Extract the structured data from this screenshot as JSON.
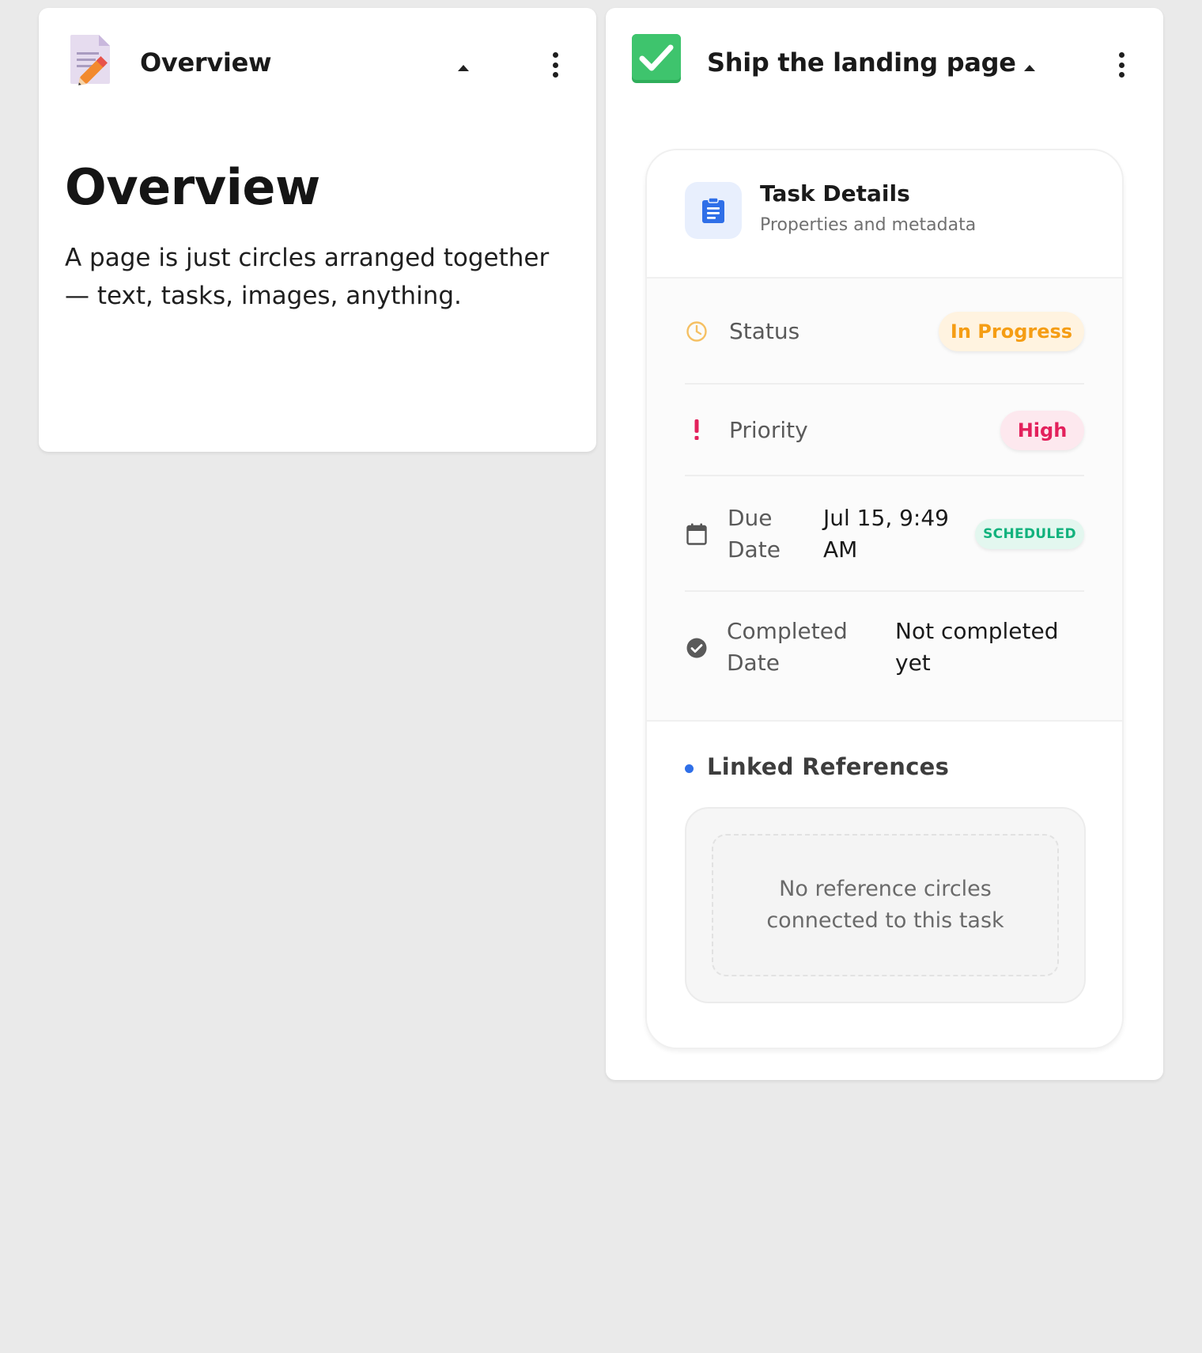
{
  "left_card": {
    "header_title": "Overview",
    "heading": "Overview",
    "body": "A page is just circles arranged together — text, tasks, images, anything."
  },
  "right_card": {
    "header_title": "Ship the landing page",
    "details": {
      "title": "Task Details",
      "subtitle": "Properties and metadata",
      "status": {
        "label": "Status",
        "value": "In Progress"
      },
      "priority": {
        "label": "Priority",
        "value": "High"
      },
      "due_date": {
        "label_line1": "Due",
        "label_line2": "Date",
        "value_line1": "Jul 15, 9:49",
        "value_line2": "AM",
        "badge": "SCHEDULED"
      },
      "completed_date": {
        "label_line1": "Completed",
        "label_line2": "Date",
        "value_line1": "Not completed",
        "value_line2": "yet"
      }
    },
    "references": {
      "title": "Linked References",
      "empty_line1": "No reference circles",
      "empty_line2": "connected to this task"
    }
  },
  "colors": {
    "background": "#eaeaea",
    "status_accent": "#f59d14",
    "priority_accent": "#e3215c",
    "scheduled_accent": "#12b27d",
    "link_accent": "#2f6fe8",
    "task_check_green": "#3ec46d"
  },
  "icons": {
    "left_header": "document-pencil-icon",
    "right_header": "checkbox-checked-icon",
    "details": "clipboard-icon",
    "status": "clock-icon",
    "priority": "exclamation-icon",
    "due_date": "calendar-icon",
    "completed": "check-circle-icon"
  }
}
